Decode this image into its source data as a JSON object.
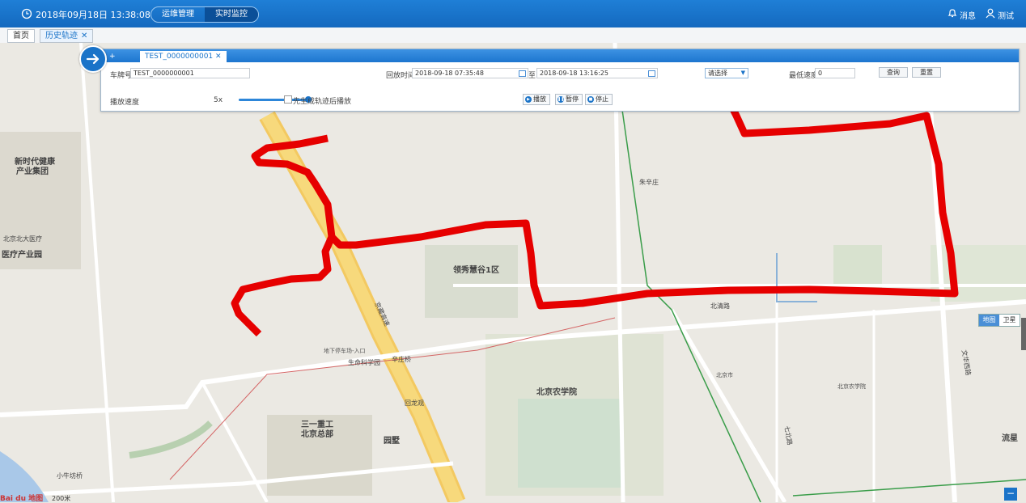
{
  "header": {
    "datetime": "2018年09月18日 13:38:08",
    "nav": [
      {
        "label": "运维管理"
      },
      {
        "label": "实时监控"
      }
    ],
    "messages_label": "消息",
    "user_label": "测试"
  },
  "page_tabs": [
    {
      "label": "首页"
    },
    {
      "label": "历史轨迹"
    }
  ],
  "panel": {
    "tabs": [
      {
        "label": "+"
      },
      {
        "label": "TEST_0000000001"
      }
    ],
    "plate_label": "车牌号",
    "plate_value": "TEST_0000000001",
    "time_label": "回放时间",
    "time_start": "2018-09-18 07:35:48",
    "time_sep": "至",
    "time_end": "2018-09-18 13:16:25",
    "select_value": "请选择",
    "min_speed_label": "最低速度",
    "min_speed_value": "0",
    "query_label": "查询",
    "reset_label": "重置",
    "speed_label": "播放速度",
    "speed_value": "5x",
    "speed_fraction": 1.0,
    "load_first_label": "先生成轨迹后播放",
    "play_label": "播放",
    "pause_label": "暂停",
    "stop_label": "停止"
  },
  "map": {
    "type_map_label": "地图",
    "type_sat_label": "卫星",
    "scale_label": "200米",
    "logo_label": "Bai du 地图",
    "route_color": "#e60000",
    "labels": {
      "l1": "新时代健康",
      "l2": "产业集团",
      "l3": "北京北大医疗",
      "l4": "医疗产业园",
      "l5": "领秀慧谷1区",
      "l6": "北京农学院",
      "l7": "三一重工",
      "l8": "北京总部",
      "l9": "回龙观",
      "l10": "京藏高速",
      "l11": "北清路",
      "l12": "生命科学园",
      "l13": "朱辛庄",
      "l14": "辛庄桥",
      "l15": "七北路",
      "l16": "文华西路",
      "l17": "流星",
      "l18": "小牛坊桥",
      "l19": "园墅",
      "l20": "地下停车场-入口",
      "l21": "北京农学院",
      "l22": "北京市"
    }
  }
}
